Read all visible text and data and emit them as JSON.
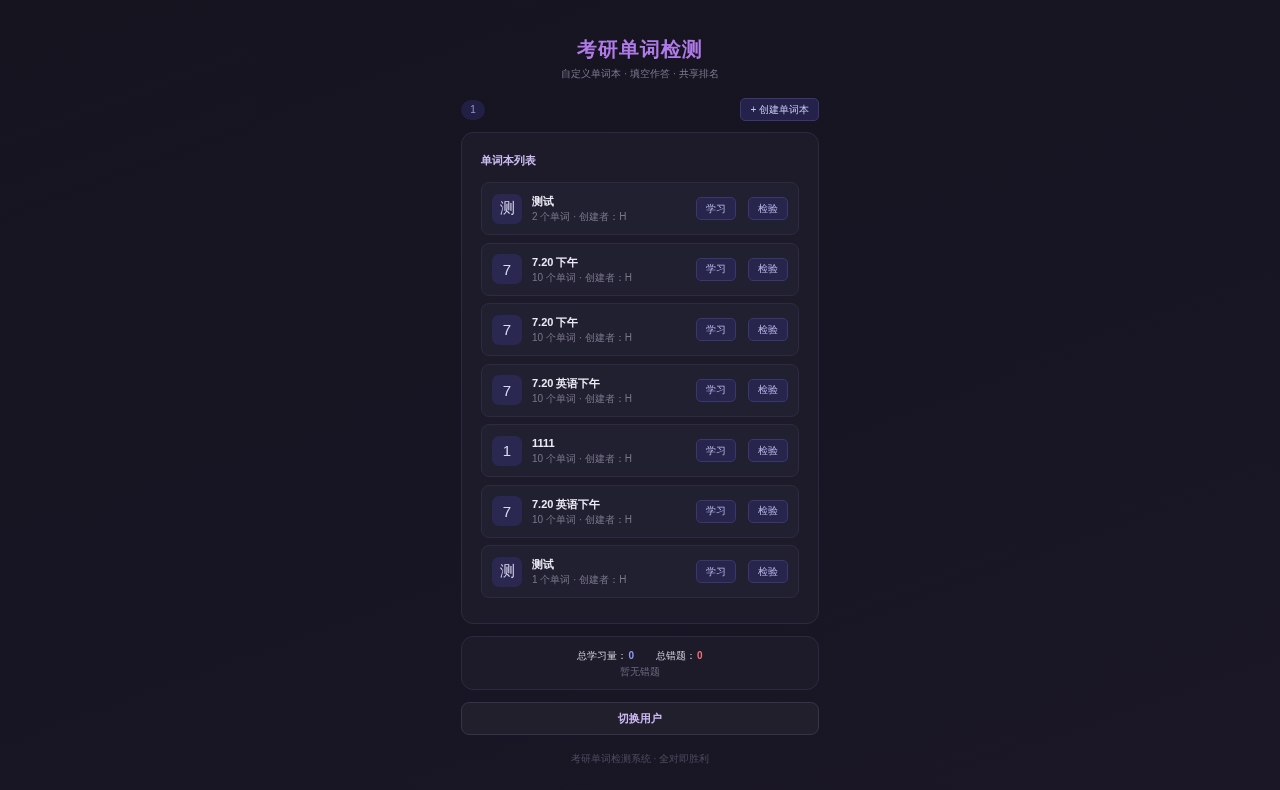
{
  "header": {
    "title": "考研单词检测",
    "subtitle": "自定义单词本 · 填空作答 · 共享排名"
  },
  "toolbar": {
    "badge": "1",
    "create_button": "+ 创建单词本"
  },
  "wordbook_list": {
    "title": "单词本列表",
    "items": [
      {
        "avatar": "测",
        "name": "测试",
        "meta": "2 个单词 · 创建者：H",
        "actions": [
          "学习",
          "检验"
        ]
      },
      {
        "avatar": "7",
        "name": "7.20 下午",
        "meta": "10 个单词 · 创建者：H",
        "actions": [
          "学习",
          "检验"
        ]
      },
      {
        "avatar": "7",
        "name": "7.20 下午",
        "meta": "10 个单词 · 创建者：H",
        "actions": [
          "学习",
          "检验"
        ]
      },
      {
        "avatar": "7",
        "name": "7.20 英语下午",
        "meta": "10 个单词 · 创建者：H",
        "actions": [
          "学习",
          "检验"
        ]
      },
      {
        "avatar": "1",
        "name": "1111",
        "meta": "10 个单词 · 创建者：H",
        "actions": [
          "学习",
          "检验"
        ]
      },
      {
        "avatar": "7",
        "name": "7.20 英语下午",
        "meta": "10 个单词 · 创建者：H",
        "actions": [
          "学习",
          "检验"
        ]
      },
      {
        "avatar": "测",
        "name": "测试",
        "meta": "1 个单词 · 创建者：H",
        "actions": [
          "学习",
          "检验"
        ]
      }
    ]
  },
  "stats": {
    "items": [
      {
        "label": "总学习量：",
        "value": "0",
        "color": "#8f9cf5"
      },
      {
        "label": "总错题：",
        "value": "0",
        "color": "#f07272"
      }
    ],
    "empty_text": "暂无错题"
  },
  "switch_user_button": "切换用户",
  "footer": "考研单词检测系统 · 全对即胜利"
}
